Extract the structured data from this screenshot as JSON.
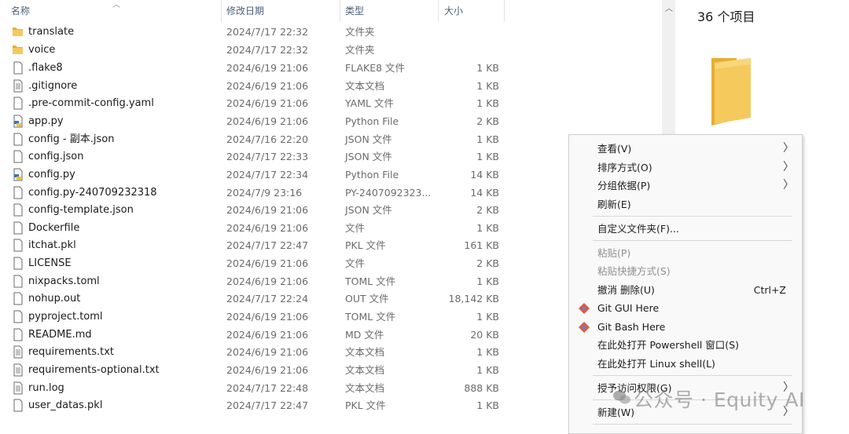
{
  "header": {
    "name": "名称",
    "date": "修改日期",
    "type": "类型",
    "size": "大小"
  },
  "files": [
    {
      "name": "translate",
      "date": "2024/7/17 22:32",
      "type": "文件夹",
      "size": "",
      "icon": "folder-icon"
    },
    {
      "name": "voice",
      "date": "2024/7/17 22:32",
      "type": "文件夹",
      "size": "",
      "icon": "folder-icon"
    },
    {
      "name": ".flake8",
      "date": "2024/6/19 21:06",
      "type": "FLAKE8 文件",
      "size": "1 KB",
      "icon": "file-icon"
    },
    {
      "name": ".gitignore",
      "date": "2024/6/19 21:06",
      "type": "文本文档",
      "size": "1 KB",
      "icon": "text-file-icon"
    },
    {
      "name": ".pre-commit-config.yaml",
      "date": "2024/6/19 21:06",
      "type": "YAML 文件",
      "size": "1 KB",
      "icon": "file-icon"
    },
    {
      "name": "app.py",
      "date": "2024/6/19 21:06",
      "type": "Python File",
      "size": "2 KB",
      "icon": "python-file-icon"
    },
    {
      "name": "config - 副本.json",
      "date": "2024/7/16 22:20",
      "type": "JSON 文件",
      "size": "1 KB",
      "icon": "file-icon"
    },
    {
      "name": "config.json",
      "date": "2024/7/17 22:33",
      "type": "JSON 文件",
      "size": "1 KB",
      "icon": "file-icon"
    },
    {
      "name": "config.py",
      "date": "2024/7/17 22:34",
      "type": "Python File",
      "size": "14 KB",
      "icon": "python-file-icon"
    },
    {
      "name": "config.py-240709232318",
      "date": "2024/7/9 23:16",
      "type": "PY-2407092323...",
      "size": "14 KB",
      "icon": "file-icon"
    },
    {
      "name": "config-template.json",
      "date": "2024/6/19 21:06",
      "type": "JSON 文件",
      "size": "2 KB",
      "icon": "file-icon"
    },
    {
      "name": "Dockerfile",
      "date": "2024/6/19 21:06",
      "type": "文件",
      "size": "1 KB",
      "icon": "file-icon"
    },
    {
      "name": "itchat.pkl",
      "date": "2024/7/17 22:47",
      "type": "PKL 文件",
      "size": "161 KB",
      "icon": "file-icon"
    },
    {
      "name": "LICENSE",
      "date": "2024/6/19 21:06",
      "type": "文件",
      "size": "2 KB",
      "icon": "file-icon"
    },
    {
      "name": "nixpacks.toml",
      "date": "2024/6/19 21:06",
      "type": "TOML 文件",
      "size": "1 KB",
      "icon": "file-icon"
    },
    {
      "name": "nohup.out",
      "date": "2024/7/17 22:24",
      "type": "OUT 文件",
      "size": "18,142 KB",
      "icon": "file-icon"
    },
    {
      "name": "pyproject.toml",
      "date": "2024/6/19 21:06",
      "type": "TOML 文件",
      "size": "1 KB",
      "icon": "file-icon"
    },
    {
      "name": "README.md",
      "date": "2024/6/19 21:06",
      "type": "MD 文件",
      "size": "20 KB",
      "icon": "file-icon"
    },
    {
      "name": "requirements.txt",
      "date": "2024/6/19 21:06",
      "type": "文本文档",
      "size": "1 KB",
      "icon": "text-file-icon"
    },
    {
      "name": "requirements-optional.txt",
      "date": "2024/6/19 21:06",
      "type": "文本文档",
      "size": "1 KB",
      "icon": "text-file-icon"
    },
    {
      "name": "run.log",
      "date": "2024/7/17 22:48",
      "type": "文本文档",
      "size": "888 KB",
      "icon": "text-file-icon"
    },
    {
      "name": "user_datas.pkl",
      "date": "2024/7/17 22:47",
      "type": "PKL 文件",
      "size": "1 KB",
      "icon": "file-icon"
    }
  ],
  "preview": {
    "count": "36 个项目"
  },
  "context_menu": {
    "view": "查看(V)",
    "sort": "排序方式(O)",
    "group": "分组依据(P)",
    "refresh": "刷新(E)",
    "customize": "自定义文件夹(F)...",
    "paste": "粘贴(P)",
    "paste_shortcut": "粘贴快捷方式(S)",
    "undo_delete": "撤消 删除(U)",
    "undo_shortcut": "Ctrl+Z",
    "git_gui": "Git GUI Here",
    "git_bash": "Git Bash Here",
    "powershell": "在此处打开 Powershell 窗口(S)",
    "linux_shell": "在此处打开 Linux shell(L)",
    "access": "授予访问权限(G)",
    "new": "新建(W)"
  },
  "watermark": "公众号 · Equity AI",
  "colors": {
    "folder": "#f5c95c",
    "folder_dark": "#e6ae35",
    "menu_bg": "#f9f9f9",
    "header_text": "#4c607a"
  }
}
